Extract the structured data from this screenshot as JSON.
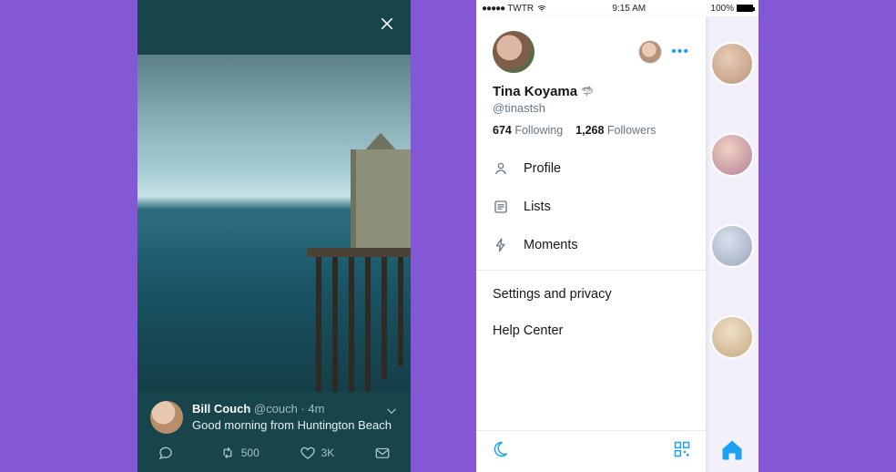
{
  "colors": {
    "bg": "#8457d7",
    "darkTeal": "#18454c",
    "twBlue": "#1da1f2",
    "muted": "#657786"
  },
  "left": {
    "tweet": {
      "author": "Bill Couch",
      "handle": "@couch",
      "sep": "·",
      "time": "4m",
      "body": "Good morning from Huntington Beach"
    },
    "actions": {
      "reply_count": "",
      "retweet_count": "500",
      "like_count": "3K"
    }
  },
  "right": {
    "status": {
      "signal": "●●●●●",
      "carrier": "TWTR",
      "time": "9:15 AM",
      "battery_pct": "100%"
    },
    "profile": {
      "name": "Tina Koyama",
      "handle": "@tinastsh",
      "following_n": "674",
      "following_l": "Following",
      "followers_n": "1,268",
      "followers_l": "Followers"
    },
    "menu": {
      "profile": "Profile",
      "lists": "Lists",
      "moments": "Moments",
      "settings": "Settings and privacy",
      "help": "Help Center"
    }
  }
}
